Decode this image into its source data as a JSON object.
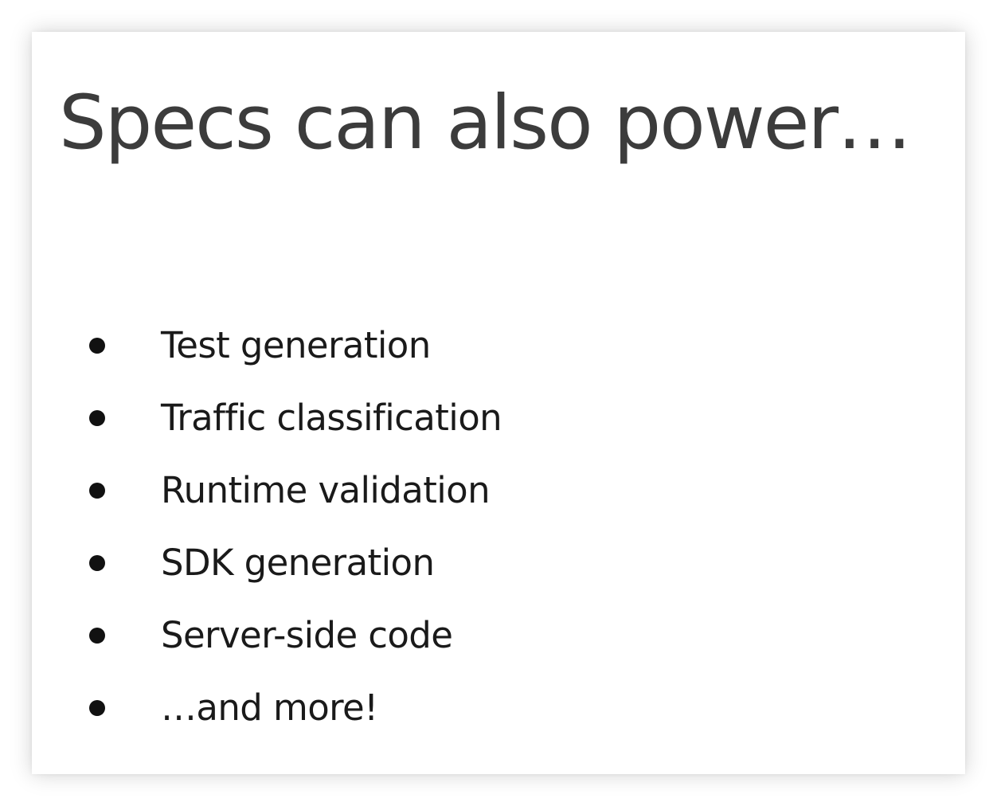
{
  "slide": {
    "title": "Specs can also power…",
    "bullets": [
      "Test generation",
      "Traffic classification",
      "Runtime validation",
      "SDK generation",
      "Server-side code",
      "…and more!"
    ]
  }
}
